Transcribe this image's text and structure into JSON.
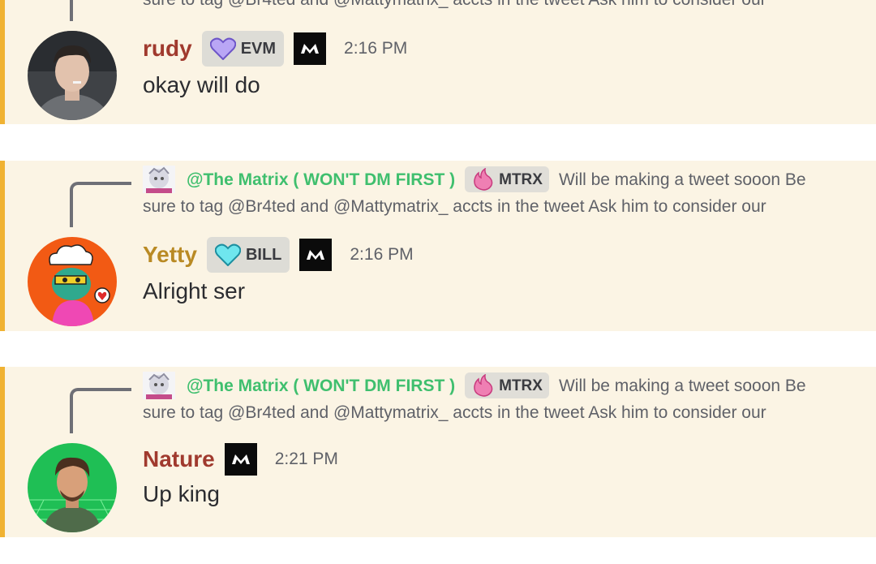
{
  "messages": [
    {
      "reply_top": {
        "tail": "sure to tag @Br4ted and @Mattymatrix_ accts in the tweet   Ask him to consider our"
      },
      "username": "rudy",
      "username_color": "#a03a2e",
      "role": "EVM",
      "role_icon": "purple-heart-icon",
      "time": "2:16 PM",
      "text": "okay will do"
    },
    {
      "reply": {
        "user": "@The Matrix ( WON'T DM FIRST )",
        "tag": "MTRX",
        "line1": "Will be making a tweet sooon    Be",
        "line2": "sure to tag @Br4ted and @Mattymatrix_ accts in the tweet   Ask him to consider our"
      },
      "username": "Yetty",
      "username_color": "#b98a24",
      "role": "BILL",
      "role_icon": "cyan-heart-icon",
      "time": "2:16 PM",
      "text": "Alright ser"
    },
    {
      "reply": {
        "user": "@The Matrix ( WON'T DM FIRST )",
        "tag": "MTRX",
        "line1": "Will be making a tweet sooon    Be",
        "line2": "sure to tag @Br4ted and @Mattymatrix_ accts in the tweet   Ask him to consider our"
      },
      "username": "Nature",
      "username_color": "#a03a2e",
      "time": "2:21 PM",
      "text": "Up king"
    }
  ]
}
